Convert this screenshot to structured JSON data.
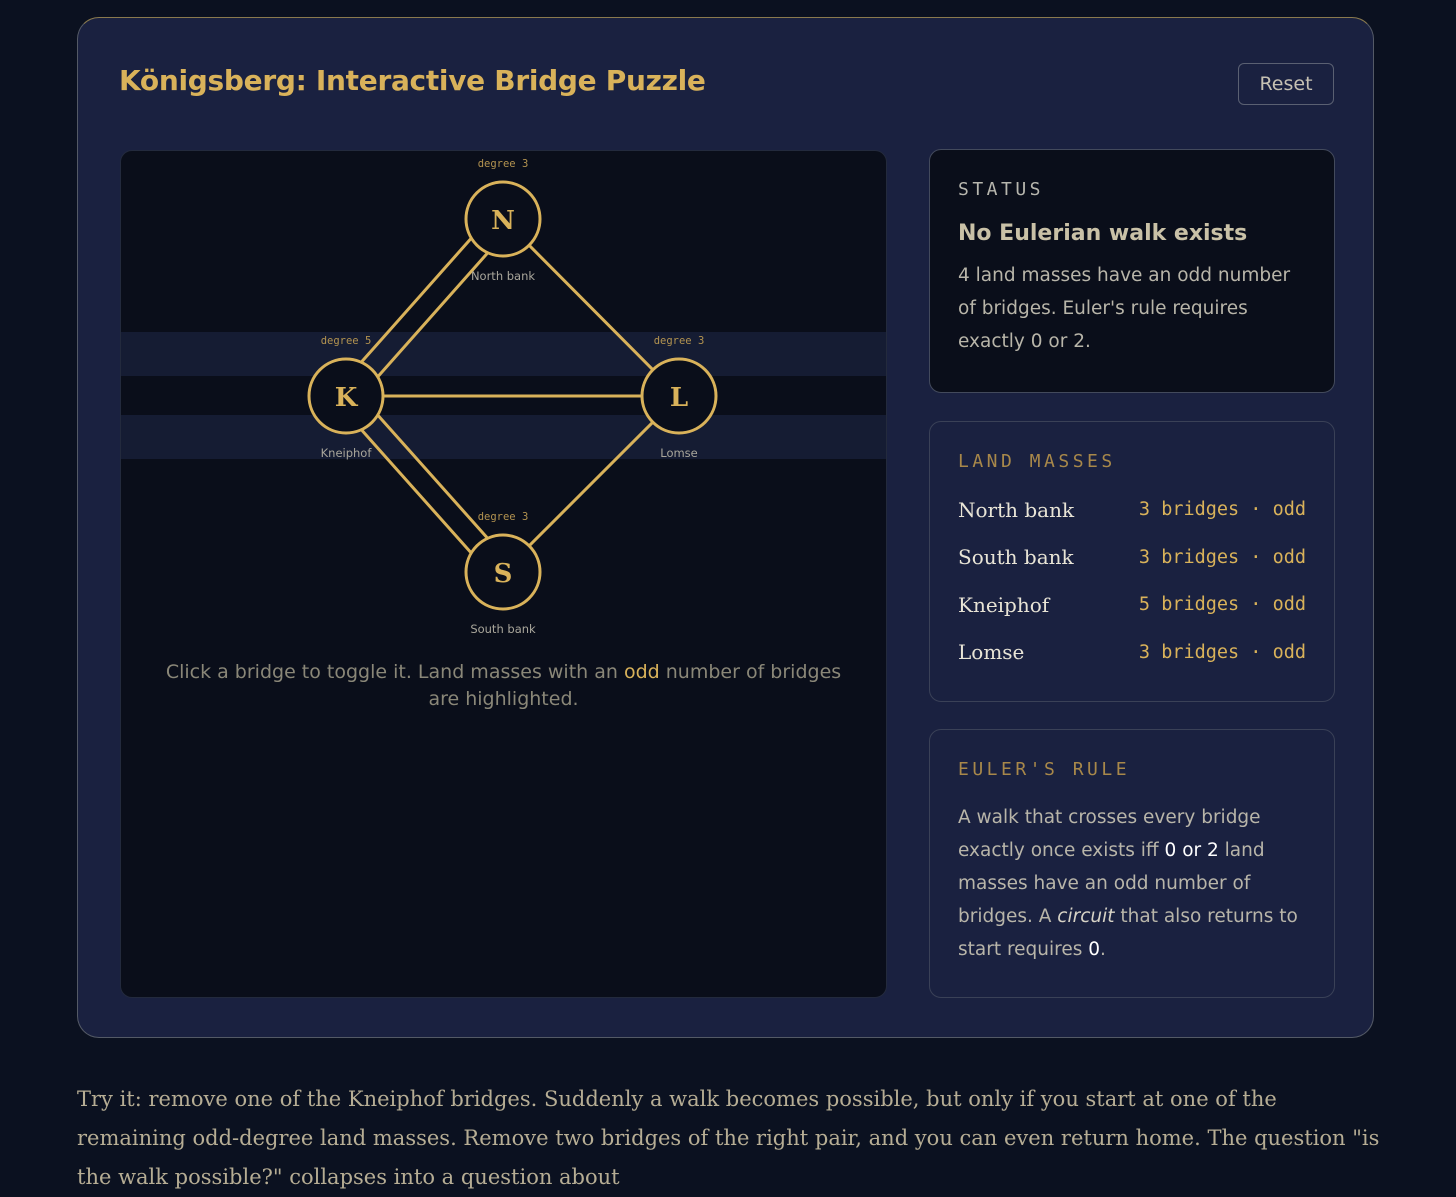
{
  "header": {
    "title": "Königsberg: Interactive Bridge Puzzle",
    "reset_label": "Reset"
  },
  "graph": {
    "nodes": [
      {
        "id": "N",
        "letter": "N",
        "label": "North bank",
        "degree_text": "degree 3"
      },
      {
        "id": "K",
        "letter": "K",
        "label": "Kneiphof",
        "degree_text": "degree 5"
      },
      {
        "id": "L",
        "letter": "L",
        "label": "Lomse",
        "degree_text": "degree 3"
      },
      {
        "id": "S",
        "letter": "S",
        "label": "South bank",
        "degree_text": "degree 3"
      }
    ],
    "bridges": [
      {
        "from": "K",
        "to": "N"
      },
      {
        "from": "K",
        "to": "N"
      },
      {
        "from": "K",
        "to": "S"
      },
      {
        "from": "K",
        "to": "S"
      },
      {
        "from": "K",
        "to": "L"
      },
      {
        "from": "N",
        "to": "L"
      },
      {
        "from": "S",
        "to": "L"
      }
    ],
    "hint_before": "Click a bridge to toggle it. Land masses with an ",
    "hint_odd": "odd",
    "hint_after": " number of bridges are highlighted."
  },
  "status": {
    "heading": "STATUS",
    "title": "No Eulerian walk exists",
    "body": "4 land masses have an odd number of bridges. Euler's rule requires exactly 0 or 2."
  },
  "land_masses": {
    "heading": "LAND MASSES",
    "items": [
      {
        "name": "North bank",
        "info": "3 bridges · odd"
      },
      {
        "name": "South bank",
        "info": "3 bridges · odd"
      },
      {
        "name": "Kneiphof",
        "info": "5 bridges · odd"
      },
      {
        "name": "Lomse",
        "info": "3 bridges · odd"
      }
    ]
  },
  "rule": {
    "heading": "EULER'S RULE",
    "part1": "A walk that crosses every bridge exactly once exists iff ",
    "hl1": "0 or 2",
    "part2": " land masses have an odd number of bridges. A ",
    "em": "circuit",
    "part3": " that also returns to start requires ",
    "hl2": "0",
    "part4": "."
  },
  "footer": {
    "text": "Try it: remove one of the Kneiphof bridges. Suddenly a walk becomes possible, but only if you start at one of the remaining odd-degree land masses. Remove two bridges of the right pair, and you can even return home. The question \"is the walk possible?\" collapses into a question about"
  },
  "colors": {
    "gold": "#d9b25a",
    "panel_bg": "#0a0e1a",
    "card_bg": "#1a2140",
    "page_bg": "#0b1120"
  }
}
